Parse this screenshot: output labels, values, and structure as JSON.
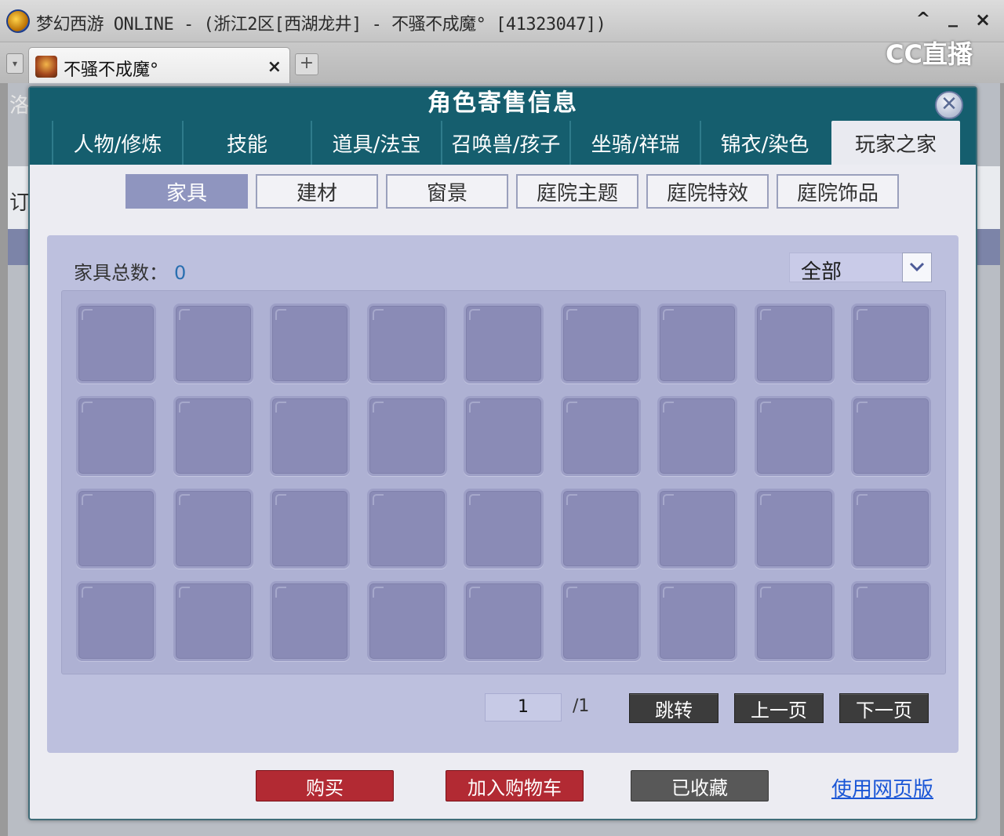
{
  "window": {
    "title": "梦幻西游 ONLINE - (浙江2区[西湖龙井] - 不骚不成魔° [41323047])",
    "controls": [
      "^",
      "_",
      "×"
    ]
  },
  "browser_tab": {
    "title": "不骚不成魔°",
    "close": "×",
    "dropdown": "▾",
    "new_tab": "+"
  },
  "watermark": "CC直播",
  "background_fragments": [
    "洛",
    "订"
  ],
  "dialog": {
    "title": "角色寄售信息",
    "close_label": "✕",
    "main_tabs": [
      "人物/修炼",
      "技能",
      "道具/法宝",
      "召唤兽/孩子",
      "坐骑/祥瑞",
      "锦衣/染色",
      "玩家之家"
    ],
    "active_main_tab": 6,
    "sub_tabs": [
      "家具",
      "建材",
      "窗景",
      "庭院主题",
      "庭院特效",
      "庭院饰品"
    ],
    "active_sub_tab": 0,
    "count_label": "家具总数：",
    "count_value": "0",
    "filter_value": "全部",
    "filter_icon": "chevron-down-icon",
    "grid": {
      "rows": 4,
      "cols": 9
    },
    "pager": {
      "current_page": "1",
      "total_pages": "/1",
      "jump": "跳转",
      "prev": "上一页",
      "next": "下一页"
    },
    "actions": {
      "buy": "购买",
      "add_cart": "加入购物车",
      "favorited": "已收藏",
      "web_version": "使用网页版"
    }
  },
  "colors": {
    "header": "#155e6e",
    "panel": "#bdc0de",
    "slot": "#8a8bb6",
    "buy": "#b22a33",
    "link": "#1a56d6"
  }
}
